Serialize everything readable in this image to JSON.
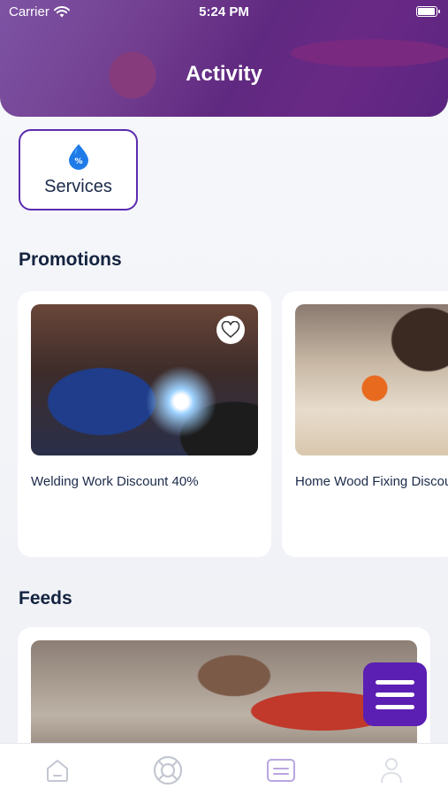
{
  "status_bar": {
    "carrier": "Carrier",
    "time": "5:24 PM",
    "battery_level": 0.95
  },
  "header": {
    "title": "Activity"
  },
  "services": {
    "label": "Services",
    "icon": "percent-drop-icon",
    "accent": "#5b2bb0"
  },
  "promotions": {
    "title": "Promotions",
    "items": [
      {
        "caption": "Welding Work Discount 40%",
        "favorite_icon": "heart-icon"
      },
      {
        "caption": "Home Wood Fixing Discou"
      }
    ]
  },
  "feeds": {
    "title": "Feeds"
  },
  "fab": {
    "icon": "menu-icon",
    "color": "#5b1fb3"
  },
  "tabbar": {
    "items": [
      {
        "icon": "home-icon"
      },
      {
        "icon": "lifebuoy-icon"
      },
      {
        "icon": "card-icon",
        "active": true
      },
      {
        "icon": "profile-icon"
      }
    ]
  }
}
